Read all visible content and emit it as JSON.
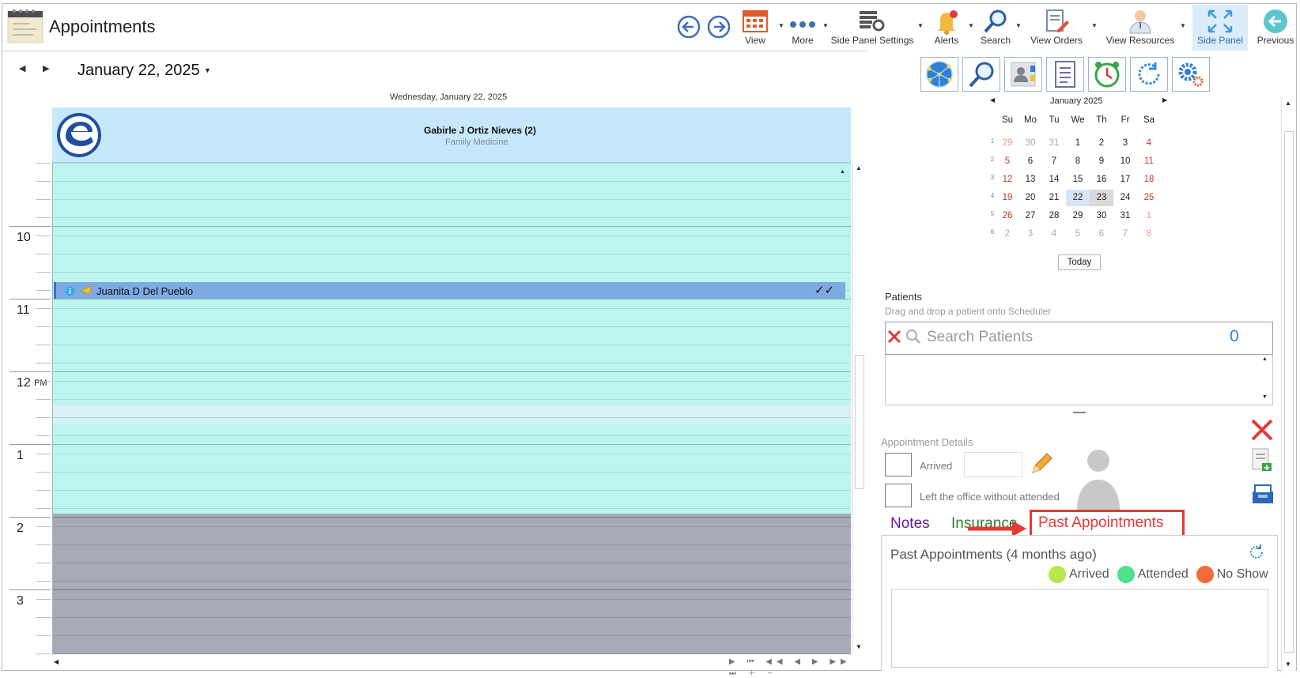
{
  "header": {
    "title": "Appointments",
    "toolbar": {
      "view": "View",
      "more": "More",
      "side_panel_settings": "Side Panel Settings",
      "alerts": "Alerts",
      "search": "Search",
      "view_orders": "View Orders",
      "view_resources": "View Resources",
      "side_panel": "Side Panel",
      "previous": "Previous"
    }
  },
  "scheduler": {
    "current_date": "January 22, 2025",
    "day_label": "Wednesday, January 22, 2025",
    "resource": {
      "name": "Gabirle J Ortiz Nieves (2)",
      "specialty": "Family Medicine"
    },
    "hours": [
      {
        "label": "10",
        "suffix": ""
      },
      {
        "label": "11",
        "suffix": ""
      },
      {
        "label": "12",
        "suffix": "PM"
      },
      {
        "label": "1",
        "suffix": ""
      },
      {
        "label": "2",
        "suffix": ""
      },
      {
        "label": "3",
        "suffix": ""
      }
    ],
    "appointment": {
      "patient": "Juanita D Del Pueblo",
      "status_marks": "✓✓"
    }
  },
  "mini_calendar": {
    "month_label": "January 2025",
    "weekdays": [
      "Su",
      "Mo",
      "Tu",
      "We",
      "Th",
      "Fr",
      "Sa"
    ],
    "week_numbers": [
      "1",
      "2",
      "3",
      "4",
      "5",
      "6"
    ],
    "weeks": [
      [
        "29",
        "30",
        "31",
        "1",
        "2",
        "3",
        "4"
      ],
      [
        "5",
        "6",
        "7",
        "8",
        "9",
        "10",
        "11"
      ],
      [
        "12",
        "13",
        "14",
        "15",
        "16",
        "17",
        "18"
      ],
      [
        "19",
        "20",
        "21",
        "22",
        "23",
        "24",
        "25"
      ],
      [
        "26",
        "27",
        "28",
        "29",
        "30",
        "31",
        "1"
      ],
      [
        "2",
        "3",
        "4",
        "5",
        "6",
        "7",
        "8"
      ]
    ],
    "today_button": "Today"
  },
  "patients": {
    "heading": "Patients",
    "hint": "Drag and drop a patient onto Scheduler",
    "search_placeholder": "Search Patients",
    "count": "0"
  },
  "appointment_details": {
    "heading": "Appointment Details",
    "arrived_label": "Arrived",
    "left_office_label": "Left the office without attended"
  },
  "tabs": {
    "notes": "Notes",
    "insurance": "Insurance",
    "past_appointments": "Past Appointments"
  },
  "past_appointments": {
    "heading": "Past Appointments (4 months ago)",
    "legend": [
      {
        "label": "Arrived",
        "color": "#b5e84a"
      },
      {
        "label": "Attended",
        "color": "#4ee08c"
      },
      {
        "label": "No Show",
        "color": "#f26b3a"
      }
    ]
  },
  "colors": {
    "slot": "#bdf5ee",
    "slot_highlight": "#d9f1f4",
    "off_hours": "#a8abb5",
    "appointment": "#7ea9e1",
    "weekend_red": "#c0392b",
    "callout_red": "#e53935"
  }
}
